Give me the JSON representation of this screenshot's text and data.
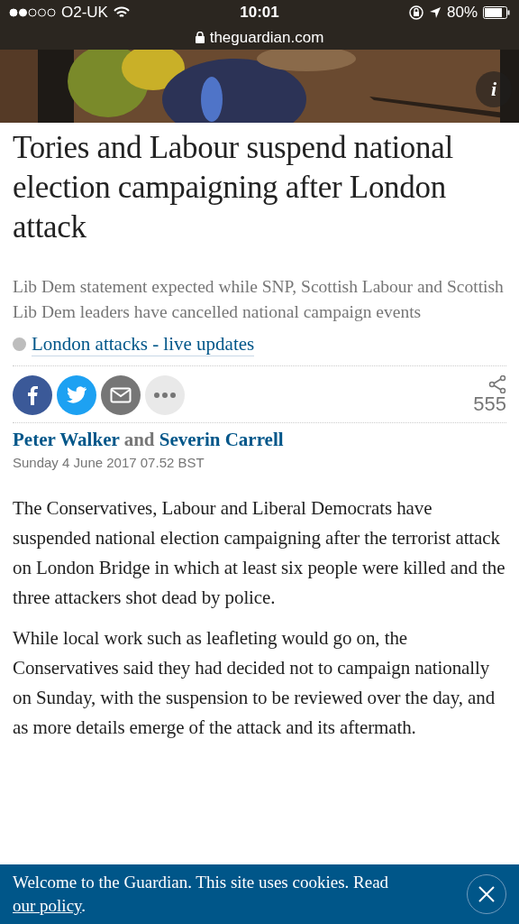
{
  "status_bar": {
    "carrier": "O2-UK",
    "time": "10:01",
    "battery": "80%"
  },
  "address_bar": {
    "url": "theguardian.com"
  },
  "hero": {
    "kind": "picture",
    "info_button": "i"
  },
  "headline": "Tories and Labour suspend national election campaigning after London attack",
  "standfirst": "Lib Dem statement expected while SNP, Scottish Labour and Scottish Lib Dem leaders have cancelled national campaign events",
  "live_link": "London attacks - live updates",
  "share_buttons": [
    {
      "kind": "facebook"
    },
    {
      "kind": "twitter"
    },
    {
      "kind": "email"
    },
    {
      "kind": "more"
    }
  ],
  "share_count": "555",
  "byline": {
    "authors": [
      "Peter Walker",
      "Severin Carrell"
    ],
    "conjunction": "and"
  },
  "dateline": "Sunday 4 June 2017 07.52 BST",
  "body": [
    "The Conservatives, Labour and Liberal Democrats have suspended national election campaigning after the terrorist attack on London Bridge in which at least six people were killed and the three attackers shot dead by police.",
    "While local work such as leafleting would go on, the Conservatives said they had decided not to campaign nationally on Sunday, with the suspension to be reviewed over the day, and as more details emerge of the attack and its aftermath."
  ],
  "cookie_banner": {
    "text": "Welcome to the Guardian. This site uses cookies. Read",
    "link": "our policy",
    "end": "."
  }
}
